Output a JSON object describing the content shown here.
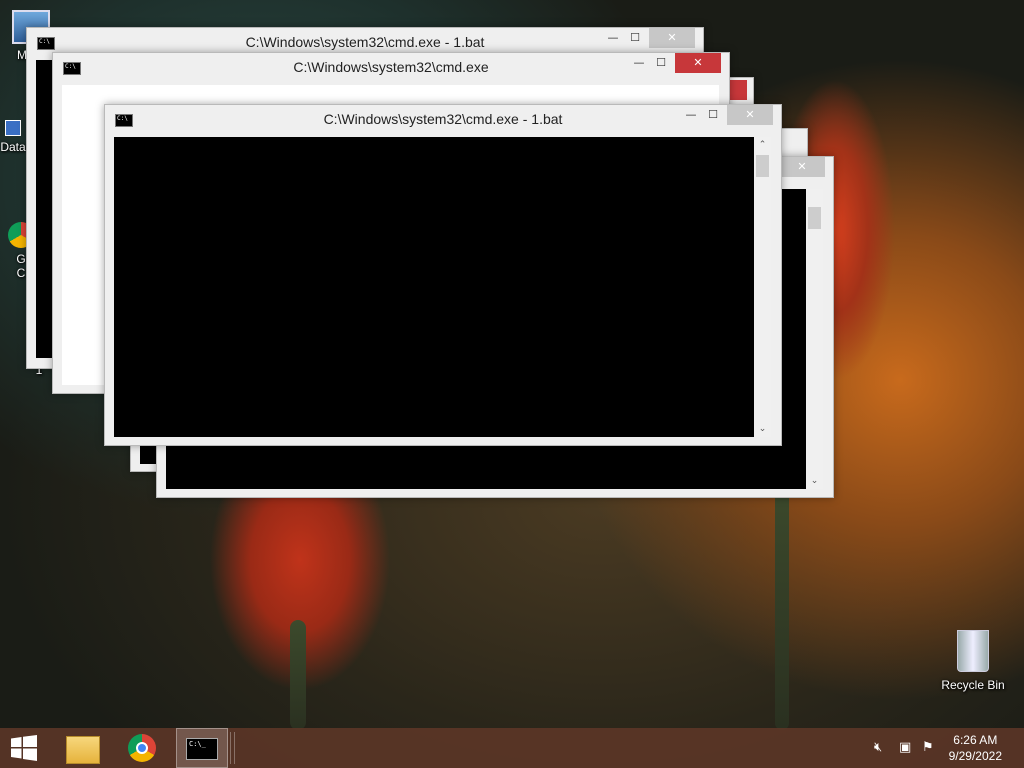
{
  "desktop": {
    "icons": [
      {
        "label": "My C"
      },
      {
        "label": "Data"
      },
      {
        "label": "G"
      },
      {
        "label": "C"
      },
      {
        "label": "1"
      },
      {
        "label": "Recycle Bin"
      }
    ]
  },
  "windows": [
    {
      "title": "C:\\Windows\\system32\\cmd.exe - 1.bat",
      "minimize": "—",
      "maximize": "☐",
      "close": "✕"
    },
    {
      "title": "C:\\Windows\\system32\\cmd.exe",
      "minimize": "—",
      "maximize": "☐",
      "close": "✕"
    },
    {
      "title": "C:\\Windows\\system32\\cmd.exe - 1.bat",
      "minimize": "—",
      "maximize": "☐",
      "close": "✕"
    },
    {
      "close": "✕"
    }
  ],
  "taskbar": {
    "start_icon": "windows-logo-icon",
    "pinned": [
      "file-explorer-icon",
      "chrome-icon",
      "cmd-icon"
    ],
    "tray_icons": [
      "volume-muted-icon",
      "network-icon",
      "action-center-flag-icon"
    ],
    "clock": {
      "time": "6:26 AM",
      "date": "9/29/2022"
    }
  },
  "colors": {
    "close_red": "#c7373a",
    "taskbar": "#5f3728"
  }
}
